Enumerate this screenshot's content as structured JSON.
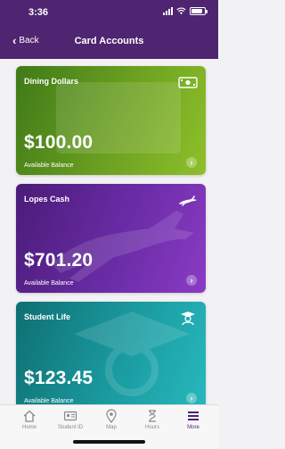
{
  "status": {
    "time": "3:36"
  },
  "nav": {
    "back_label": "Back",
    "title": "Card Accounts"
  },
  "cards": [
    {
      "title": "Dining Dollars",
      "amount": "$100.00",
      "caption": "Available Balance",
      "icon": "cash-icon"
    },
    {
      "title": "Lopes Cash",
      "amount": "$701.20",
      "caption": "Available Balance",
      "icon": "antelope-icon"
    },
    {
      "title": "Student Life",
      "amount": "$123.45",
      "caption": "Available Balance",
      "icon": "graduate-icon"
    }
  ],
  "tabs": [
    {
      "label": "Home",
      "icon": "home-icon"
    },
    {
      "label": "Student ID",
      "icon": "id-card-icon"
    },
    {
      "label": "Map",
      "icon": "map-pin-icon"
    },
    {
      "label": "Hours",
      "icon": "hourglass-icon"
    },
    {
      "label": "More",
      "icon": "menu-icon",
      "active": true
    }
  ],
  "colors": {
    "brand": "#4f2470",
    "dining": "#6da121",
    "lopes": "#6a2ca6",
    "student_life": "#1a9ba0"
  }
}
